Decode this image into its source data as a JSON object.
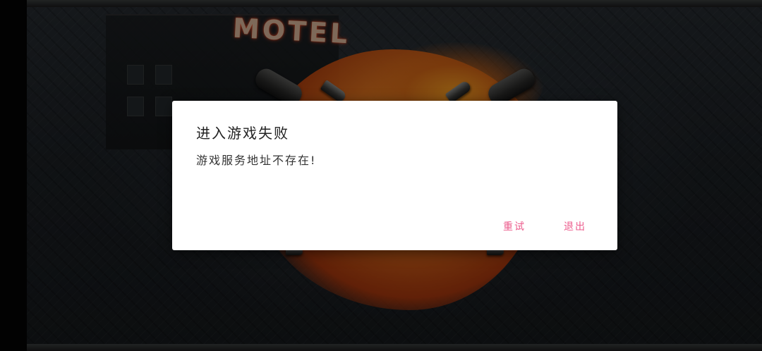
{
  "background": {
    "sign_text": "MOTEL"
  },
  "dialog": {
    "title": "进入游戏失败",
    "message": "游戏服务地址不存在!",
    "buttons": {
      "retry_label": "重试",
      "exit_label": "退出"
    },
    "accent_color": "#ec5b8c"
  }
}
